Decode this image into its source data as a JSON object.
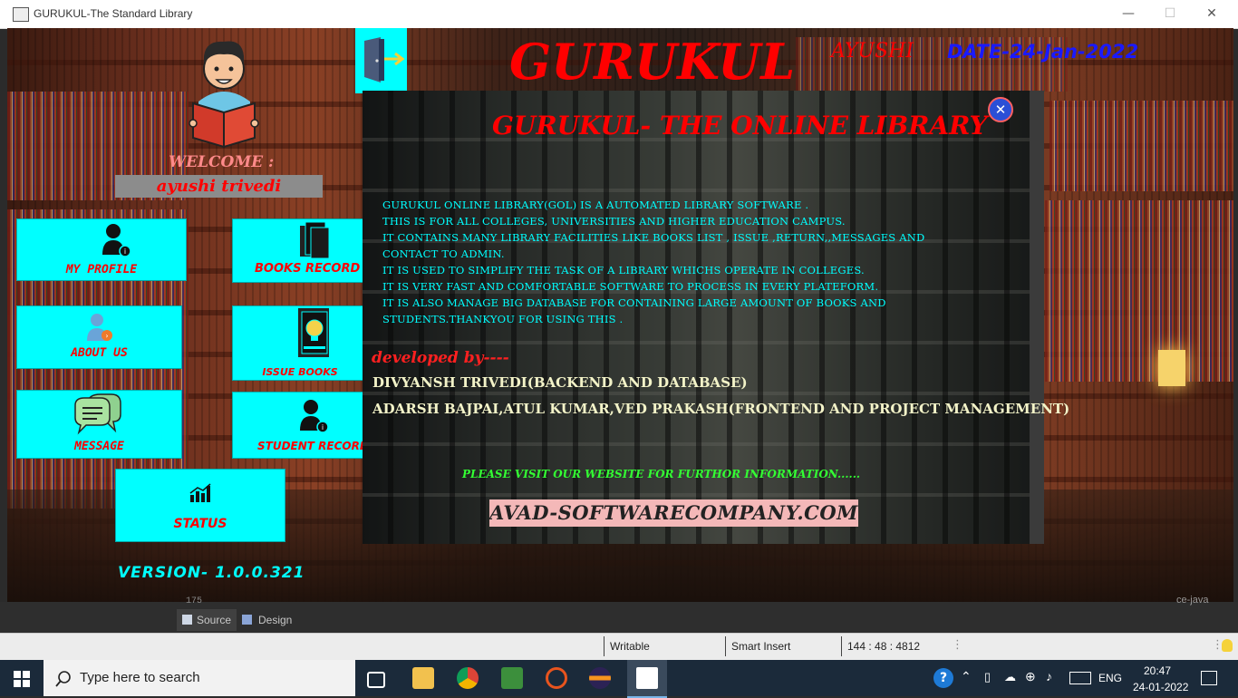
{
  "window": {
    "title": "GURUKUL-The Standard Library",
    "minimize": "—",
    "maximize": "☐",
    "close": "✕"
  },
  "sidebar": {
    "welcome": "WELCOME :",
    "username": "ayushi  trivedi",
    "tiles": {
      "my_profile": "MY PROFILE",
      "books_record": "BOOKS RECORD",
      "about_us": "ABOUT US",
      "issue_books": "ISSUE BOOKS",
      "message": "MESSAGE",
      "student_record": "STUDENT RECORD",
      "status": "STATUS"
    },
    "version": "VERSION- 1.0.0.321"
  },
  "header": {
    "app_title": "GURUKUL",
    "user_short": "AYUSHI",
    "date": "DATE-24-Jan-2022"
  },
  "dialog": {
    "title": "GURUKUL- THE ONLINE LIBRARY",
    "close_label": "✕",
    "description_lines": [
      "GURUKUL ONLINE LIBRARY(GOL) IS A   AUTOMATED LIBRARY SOFTWARE .",
      "THIS IS  FOR ALL COLLEGES, UNIVERSITIES AND  HIGHER EDUCATION CAMPUS.",
      "IT CONTAINS MANY LIBRARY FACILITIES LIKE BOOKS LIST , ISSUE ,RETURN,,MESSAGES AND",
      "CONTACT TO ADMIN.",
      "IT IS USED TO SIMPLIFY THE TASK OF A LIBRARY WHICHS OPERATE IN COLLEGES.",
      "IT IS VERY FAST AND COMFORTABLE SOFTWARE TO PROCESS IN EVERY PLATEFORM.",
      "IT IS ALSO MANAGE BIG DATABASE FOR CONTAINING LARGE AMOUNT OF BOOKS AND",
      "STUDENTS.THANKYOU FOR USING THIS ."
    ],
    "developed_by": "developed by----",
    "developers": [
      "DIVYANSH TRIVEDI(BACKEND AND DATABASE)",
      "ADARSH BAJPAI,ATUL KUMAR,VED PRAKASH(FRONTEND AND PROJECT MANAGEMENT)"
    ],
    "visit_text": "PLEASE VISIT OUR WEBSITE FOR FURTHOR INFORMATION......",
    "website": "AVAD-SOFTWARECOMPANY.COM"
  },
  "ide": {
    "line_number": "175",
    "right_fragment": "ce-java",
    "tab_source": "Source",
    "tab_design": "Design",
    "status_writable": "Writable",
    "status_insert": "Smart Insert",
    "status_pos": "144 : 48 : 4812"
  },
  "taskbar": {
    "search_placeholder": "Type here to search",
    "language": "ENG",
    "time": "20:47",
    "date": "24-01-2022"
  },
  "colors": {
    "tile_bg": "#00ffff",
    "tile_text": "#ff0000",
    "title_red": "#ff0000",
    "date_blue": "#1a1aff",
    "desc_cyan": "#00ffff"
  }
}
